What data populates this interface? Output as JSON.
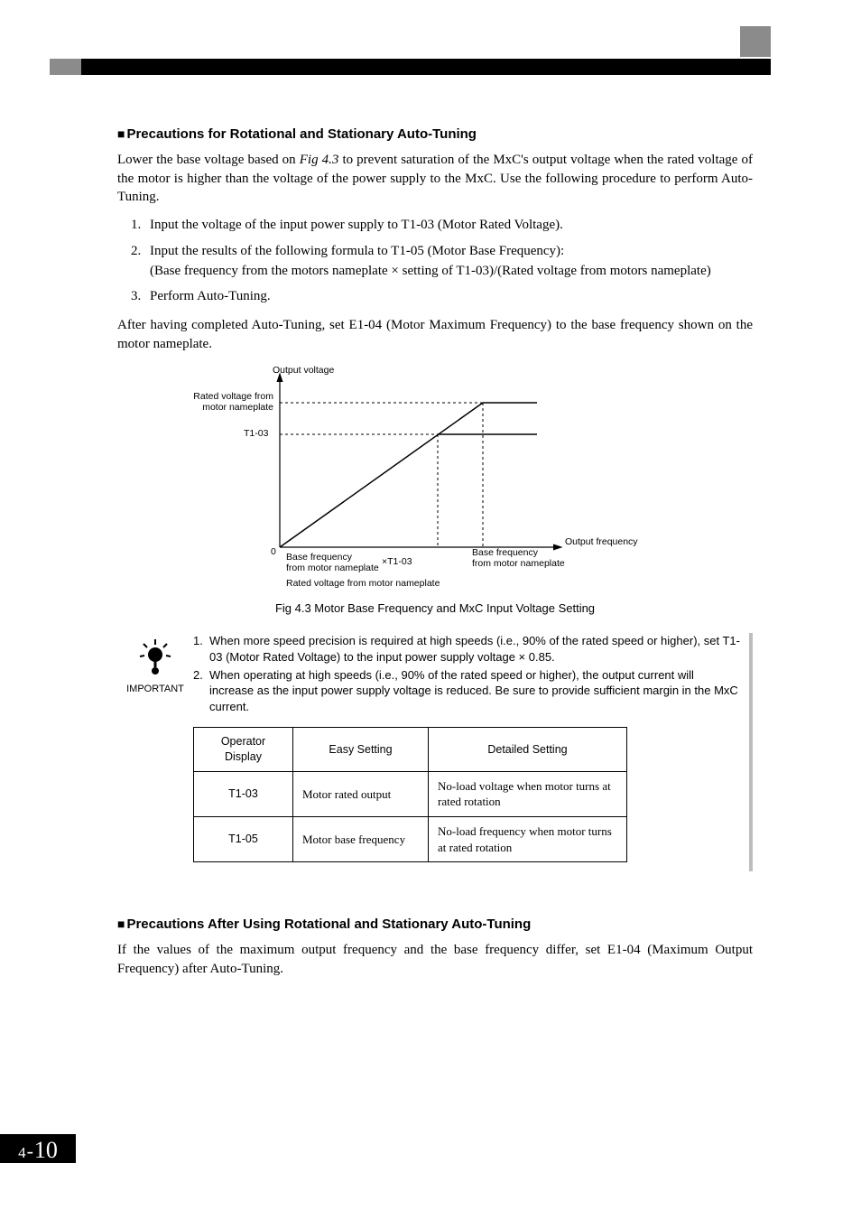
{
  "section1": {
    "title": "Precautions for Rotational and Stationary Auto-Tuning",
    "intro_a": "Lower the base voltage based on ",
    "intro_ref": "Fig 4.3",
    "intro_b": " to prevent saturation of the MxC's output voltage when the rated voltage of the motor is higher than the voltage of the power supply to the MxC. Use the following procedure to perform Auto-Tuning.",
    "steps": [
      "Input the voltage of the input power supply to T1-03 (Motor Rated Voltage).",
      "Input the results of the following formula to T1-05 (Motor Base Frequency):",
      "Perform Auto-Tuning."
    ],
    "step2_detail": "(Base frequency from the motors nameplate × setting of T1-03)/(Rated voltage from motors nameplate)",
    "after": "After having completed Auto-Tuning, set E1-04 (Motor Maximum Frequency) to the base frequency shown on the motor nameplate."
  },
  "figure": {
    "caption": "Fig 4.3  Motor Base Frequency and MxC Input Voltage Setting",
    "labels": {
      "y_axis": "Output voltage",
      "rated_v": "Rated voltage from\nmotor nameplate",
      "t1_03": "T1-03",
      "zero": "0",
      "base_freq_left": "Base frequency\nfrom motor nameplate",
      "times_t1_03": "×T1-03",
      "rated_v_bottom": "Rated voltage from motor nameplate",
      "base_freq_right": "Base frequency\nfrom motor nameplate",
      "x_axis": "Output frequency"
    }
  },
  "important": {
    "label": "IMPORTANT",
    "note1": "When more speed precision is required at high speeds (i.e., 90% of the rated speed or higher), set T1-03 (Motor Rated Voltage) to the input power supply voltage × 0.85.",
    "note2": "When operating at high speeds (i.e., 90% of the rated speed or higher), the output current will increase as the input power supply voltage is reduced. Be sure to provide sufficient margin in the MxC current."
  },
  "table": {
    "headers": [
      "Operator Display",
      "Easy Setting",
      "Detailed Setting"
    ],
    "rows": [
      {
        "op": "T1-03",
        "easy": "Motor rated output",
        "det": "No-load voltage when motor turns at rated rotation"
      },
      {
        "op": "T1-05",
        "easy": "Motor base frequency",
        "det": "No-load frequency when motor turns at rated rotation"
      }
    ]
  },
  "section2": {
    "title": "Precautions After Using Rotational and Stationary Auto-Tuning",
    "body": "If the values of the maximum output frequency and the base frequency differ, set E1-04 (Maximum Output Frequency) after Auto-Tuning."
  },
  "pagenum": {
    "chapter": "4",
    "page": "10"
  }
}
